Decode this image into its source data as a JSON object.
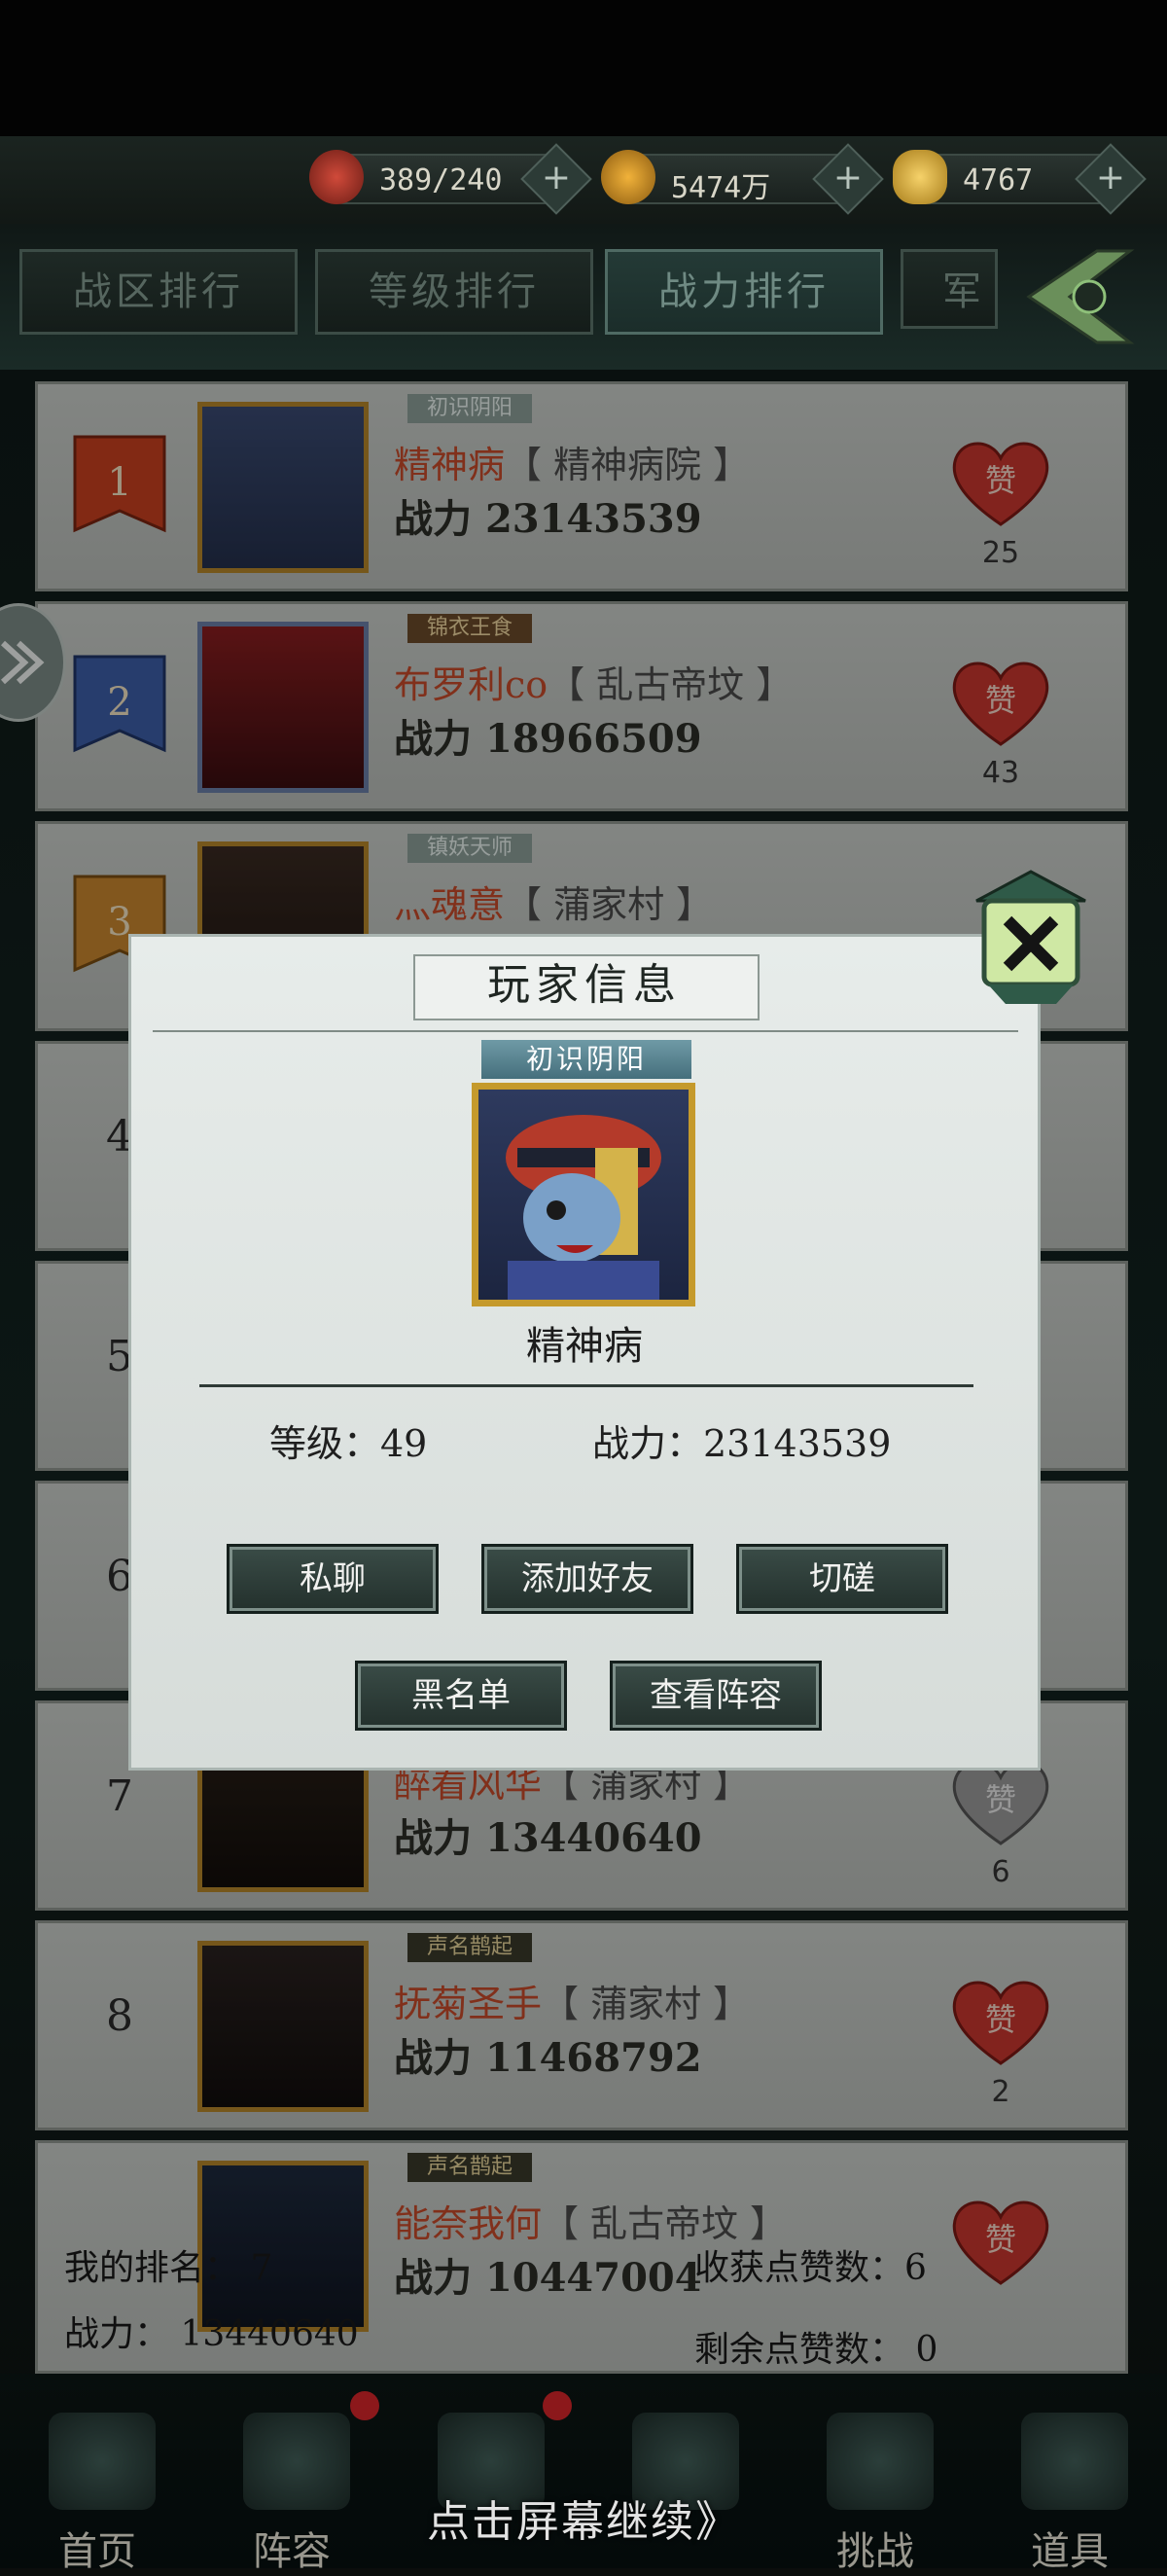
{
  "resources": [
    {
      "icon": "stamina-orb-icon",
      "value": "389/240"
    },
    {
      "icon": "copper-coin-icon",
      "value": "5474万"
    },
    {
      "icon": "gold-ingot-icon",
      "value": "4767"
    }
  ],
  "tabs": [
    {
      "label": "战区排行",
      "active": false
    },
    {
      "label": "等级排行",
      "active": false
    },
    {
      "label": "战力排行",
      "active": true
    },
    {
      "label": "军",
      "active": false
    }
  ],
  "ranking": [
    {
      "rank": "1",
      "title": "初识阴阳",
      "name": "精神病",
      "guild": "【 精神病院 】",
      "power_label": "战力",
      "power": "23143539",
      "likes": "25"
    },
    {
      "rank": "2",
      "title": "锦衣王食",
      "name": "布罗利co",
      "guild": "【 乱古帝坟 】",
      "power_label": "战力",
      "power": "18966509",
      "likes": "43"
    },
    {
      "rank": "3",
      "title": "镇妖天师",
      "name": "灬魂意",
      "guild": "【 蒲家村 】",
      "power_label": "",
      "power": "",
      "likes": ""
    },
    {
      "rank": "4"
    },
    {
      "rank": "5"
    },
    {
      "rank": "6"
    },
    {
      "rank": "7",
      "title": "",
      "name": "醉看风华",
      "guild": "【 蒲家村 】",
      "power_label": "战力",
      "power": "13440640",
      "likes": "6"
    },
    {
      "rank": "8",
      "title": "声名鹊起",
      "name": "抚菊圣手",
      "guild": "【 蒲家村 】",
      "power_label": "战力",
      "power": "11468792",
      "likes": "2"
    },
    {
      "rank": "",
      "title": "声名鹊起",
      "name": "能奈我何",
      "guild": "【 乱古帝坟 】",
      "power_label": "战力",
      "power": "10447004",
      "likes": ""
    }
  ],
  "like_label": "赞",
  "popup": {
    "title": "玩家信息",
    "player_title": "初识阴阳",
    "player_name": "精神病",
    "level_text": "等级：49",
    "power_text": "战力：23143539",
    "buttons": [
      "私聊",
      "添加好友",
      "切磋",
      "黑名单",
      "查看阵容"
    ]
  },
  "my_info": {
    "rank_text": "我的排名： 7",
    "power_text": "战力： 13440640",
    "likes_received": "收获点赞数：6",
    "likes_remaining": "剩余点赞数： 0"
  },
  "nav": [
    {
      "label": "首页",
      "badge": false
    },
    {
      "label": "阵容",
      "badge": true
    },
    {
      "label": "",
      "badge": true
    },
    {
      "label": "",
      "badge": false
    },
    {
      "label": "挑战",
      "badge": false
    },
    {
      "label": "道具",
      "badge": false
    }
  ],
  "continue_hint": "点击屏幕继续》",
  "colors": {
    "popup_bg": "#e2e8e5",
    "button_bg": "#2e3e3a",
    "name_red": "#c64a2a",
    "like_heart": "#c8372e"
  }
}
